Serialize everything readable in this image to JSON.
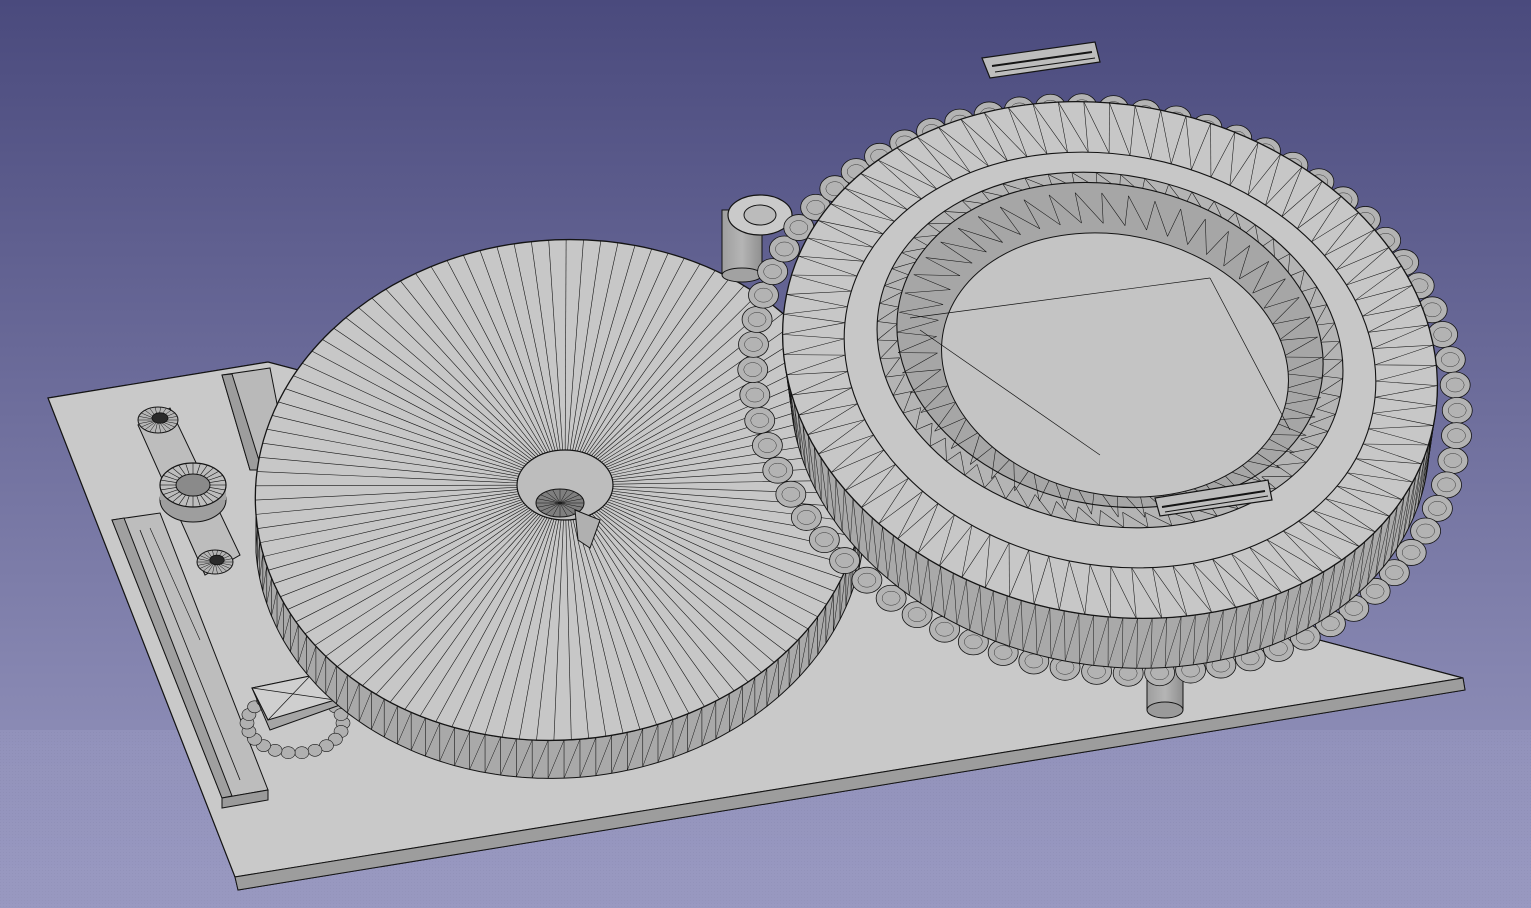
{
  "viewport": {
    "background_top_color": "#4a4a7d",
    "background_bottom_color": "#9a9ac2",
    "model_face_color": "#c7c7c7",
    "model_side_color": "#a9a9a9",
    "edge_color": "#141414"
  },
  "model": {
    "parts": [
      "base-plate",
      "large-disc",
      "toothed-ring-assembly",
      "small-gear",
      "small-pulley",
      "belt",
      "left-rail",
      "square-block",
      "support-post",
      "small-post",
      "top-clip",
      "bottom-clip"
    ]
  }
}
